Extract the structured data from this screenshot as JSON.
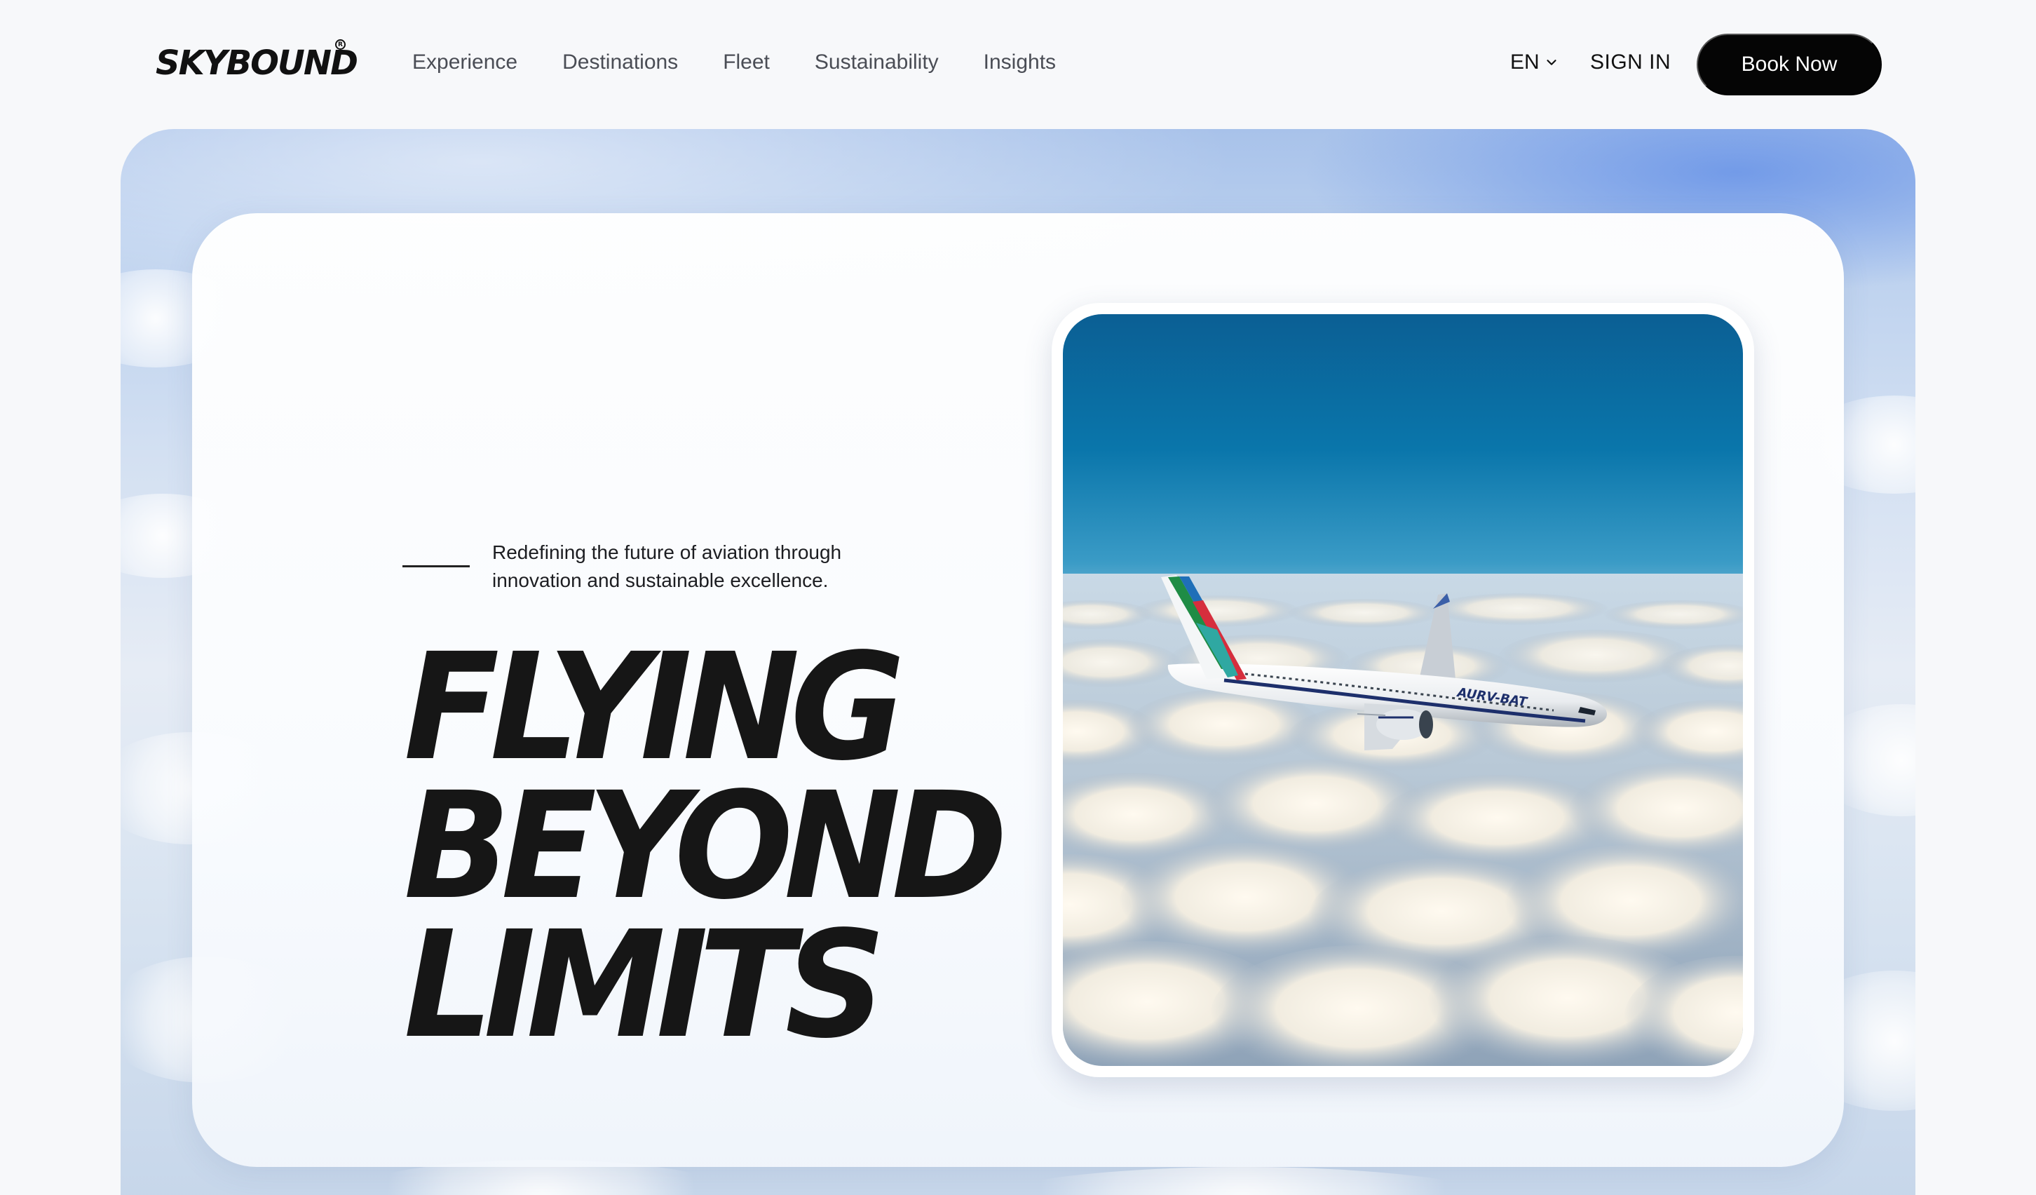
{
  "brand": {
    "name": "SKYBOUND",
    "registered_mark": "R"
  },
  "nav": {
    "links": [
      "Experience",
      "Destinations",
      "Fleet",
      "Sustainability",
      "Insights"
    ],
    "language": "EN",
    "sign_in": "SIGN IN",
    "cta": "Book Now"
  },
  "hero": {
    "tagline_line1": "Redefining the future of aviation through",
    "tagline_line2": "innovation and sustainable excellence.",
    "headline": [
      "FLYING",
      "BEYOND",
      "LIMITS"
    ]
  },
  "photo": {
    "aircraft_livery_text": "AURV-BAT",
    "icon": "airplane-over-clouds-photo"
  },
  "colors": {
    "background": "#f7f8fa",
    "cta_bg": "#050505",
    "cta_text": "#ffffff",
    "headline": "#161616",
    "nav_text": "#4a4d55",
    "sky_top": "#0a6fa8"
  }
}
